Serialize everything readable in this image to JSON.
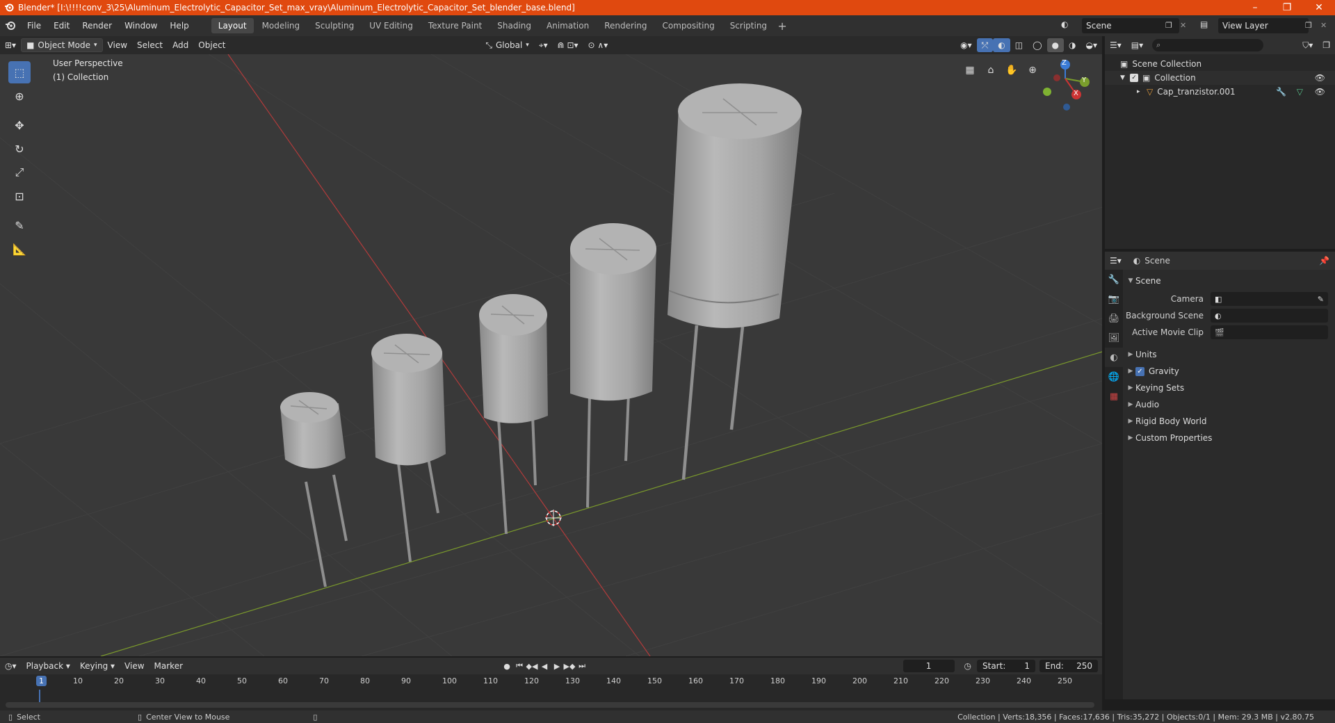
{
  "window": {
    "title": "Blender* [I:\\!!!!conv_3\\25\\Aluminum_Electrolytic_Capacitor_Set_max_vray\\Aluminum_Electrolytic_Capacitor_Set_blender_base.blend]",
    "minimize": "–",
    "maximize": "❐",
    "close": "✕"
  },
  "menu": [
    "File",
    "Edit",
    "Render",
    "Window",
    "Help"
  ],
  "workspaces": [
    "Layout",
    "Modeling",
    "Sculpting",
    "UV Editing",
    "Texture Paint",
    "Shading",
    "Animation",
    "Rendering",
    "Compositing",
    "Scripting"
  ],
  "workspace_add": "+",
  "scene_name": "Scene",
  "view_layer_name": "View Layer",
  "header3d": {
    "mode": "Object Mode",
    "view": "View",
    "select": "Select",
    "add": "Add",
    "object": "Object",
    "orientation": "Global"
  },
  "viewport": {
    "perspective": "User Perspective",
    "collection": "(1) Collection",
    "gizmo": {
      "x": "X",
      "y": "Y",
      "z": "Z"
    }
  },
  "outliner": {
    "search_placeholder": "",
    "scene_collection": "Scene Collection",
    "collection": "Collection",
    "object": "Cap_tranzistor.001"
  },
  "properties": {
    "header": "Scene",
    "panel_title": "Scene",
    "camera_label": "Camera",
    "background_scene_label": "Background Scene",
    "active_movie_clip_label": "Active Movie Clip",
    "subpanels": [
      "Units",
      "Gravity",
      "Keying Sets",
      "Audio",
      "Rigid Body World",
      "Custom Properties"
    ]
  },
  "timeline": {
    "playback": "Playback",
    "keying": "Keying",
    "view": "View",
    "marker": "Marker",
    "current_frame": "1",
    "start_label": "Start:",
    "start_value": "1",
    "end_label": "End:",
    "end_value": "250",
    "ruler": [
      "1",
      "10",
      "20",
      "30",
      "40",
      "50",
      "60",
      "70",
      "80",
      "90",
      "100",
      "110",
      "120",
      "130",
      "140",
      "150",
      "160",
      "170",
      "180",
      "190",
      "200",
      "210",
      "220",
      "230",
      "240",
      "250"
    ]
  },
  "status": {
    "select": "Select",
    "center_view": "Center View to Mouse",
    "stats": "Collection | Verts:18,356 | Faces:17,636 | Tris:35,272 | Objects:0/1 | Mem: 29.3 MB | v2.80.75"
  },
  "colors": {
    "titlebar": "#e0490f",
    "accent": "#4772b3",
    "viewport_bg": "#393939",
    "x_axis": "#c03a3a",
    "y_axis": "#7a9a2a"
  }
}
